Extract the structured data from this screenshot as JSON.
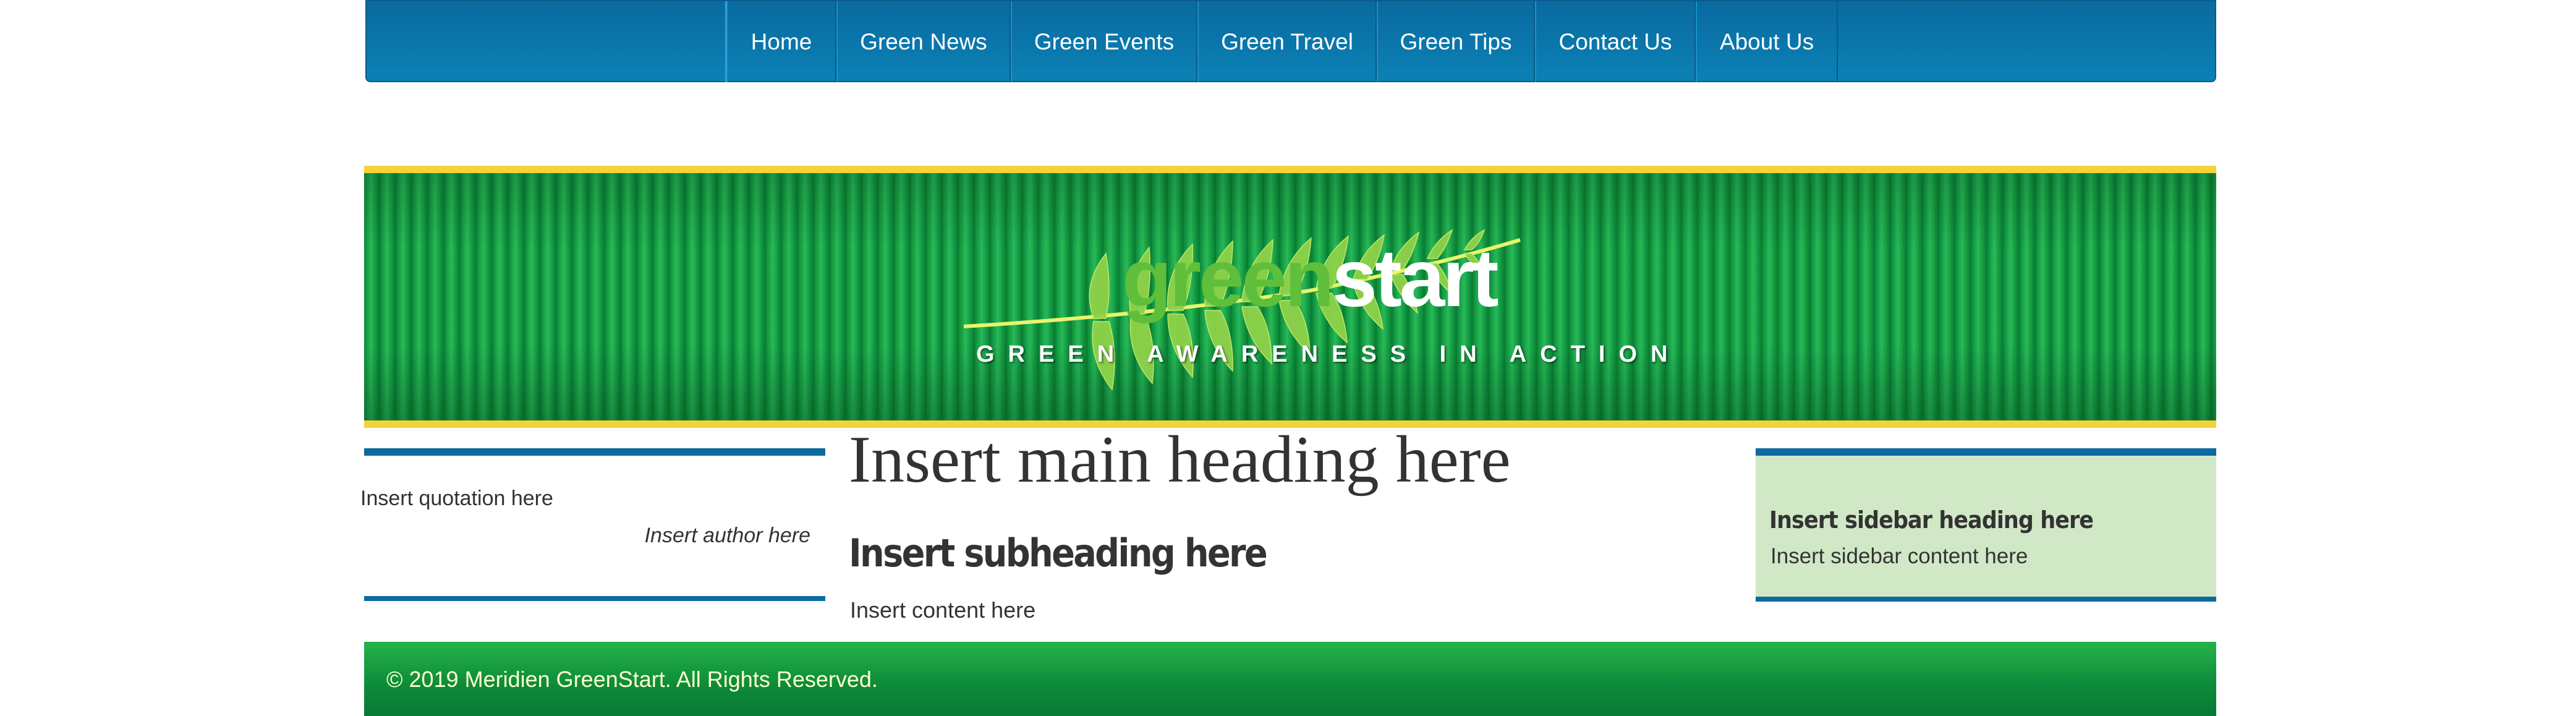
{
  "nav": {
    "items": [
      {
        "label": "Home"
      },
      {
        "label": "Green News"
      },
      {
        "label": "Green Events"
      },
      {
        "label": "Green Travel"
      },
      {
        "label": "Green Tips"
      },
      {
        "label": "Contact Us"
      },
      {
        "label": "About Us"
      }
    ]
  },
  "banner": {
    "logo_green": "green",
    "logo_white": "start",
    "tagline": "GREEN AWARENESS IN ACTION",
    "icon": "fern-leaf-icon"
  },
  "quote": {
    "text": "Insert quotation here",
    "author": "Insert author here"
  },
  "main": {
    "heading": "Insert main heading here",
    "subheading": "Insert subheading here",
    "content": "Insert content here"
  },
  "sidebar": {
    "heading": "Insert sidebar heading here",
    "content": "Insert sidebar content here"
  },
  "footer": {
    "text": "© 2019 Meridien GreenStart. All Rights Reserved."
  },
  "colors": {
    "nav_blue": "#0b81b5",
    "rule_blue": "#0b6aa0",
    "banner_green": "#1aa64a",
    "banner_yellow": "#f4d33a",
    "sidebar_bg": "#d0e8c6",
    "footer_green": "#0c8a3a",
    "footer_text": "#ffffcc"
  }
}
